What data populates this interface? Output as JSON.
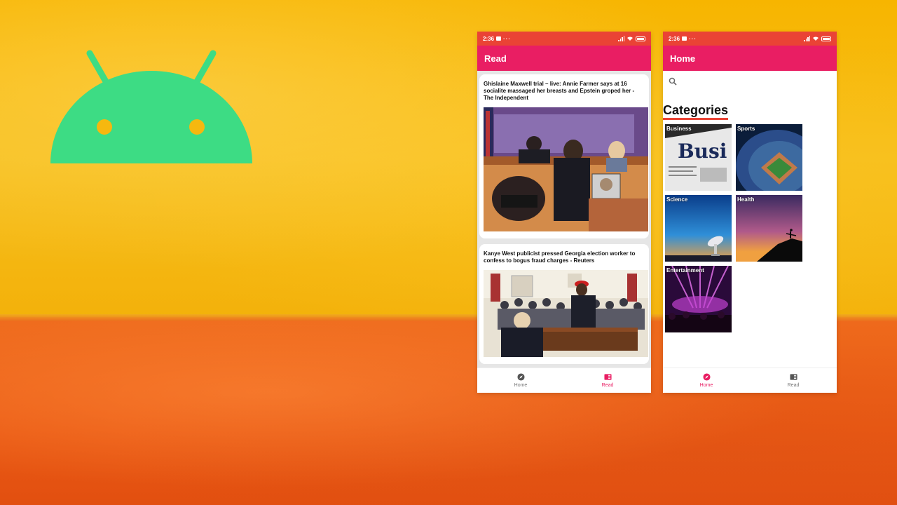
{
  "colors": {
    "status_bar": "#ea4335",
    "app_bar": "#e91e63",
    "accent": "#e91e63",
    "android_green": "#3ddc84",
    "wall_yellow": "#f6b80f",
    "wall_orange": "#ea5a14"
  },
  "read_screen": {
    "status": {
      "time": "2:36",
      "overflow": "···"
    },
    "app_bar_title": "Read",
    "articles": [
      {
        "title": "Ghislaine Maxwell trial – live: Annie Farmer says at 16 socialite massaged her breasts and Epstein groped her - The Independent",
        "image": "courtroom-sketch"
      },
      {
        "title": "Kanye West publicist pressed Georgia election worker to confess to bogus fraud charges - Reuters",
        "image": "oval-office-photo"
      }
    ],
    "nav": [
      {
        "label": "Home",
        "icon": "compass-icon",
        "active": false
      },
      {
        "label": "Read",
        "icon": "news-icon",
        "active": true
      }
    ]
  },
  "home_screen": {
    "status": {
      "time": "2:36",
      "overflow": "···"
    },
    "app_bar_title": "Home",
    "search": {
      "placeholder": "",
      "value": "",
      "icon": "search-icon"
    },
    "categories_title": "Categories",
    "categories": [
      {
        "label": "Business",
        "image": "newspaper"
      },
      {
        "label": "Sports",
        "image": "stadium"
      },
      {
        "label": "Science",
        "image": "radio-telescope"
      },
      {
        "label": "Health",
        "image": "yoga-sunset"
      },
      {
        "label": "Entertainment",
        "image": "concert-lights"
      }
    ],
    "nav": [
      {
        "label": "Home",
        "icon": "compass-icon",
        "active": true
      },
      {
        "label": "Read",
        "icon": "news-icon",
        "active": false
      }
    ]
  }
}
